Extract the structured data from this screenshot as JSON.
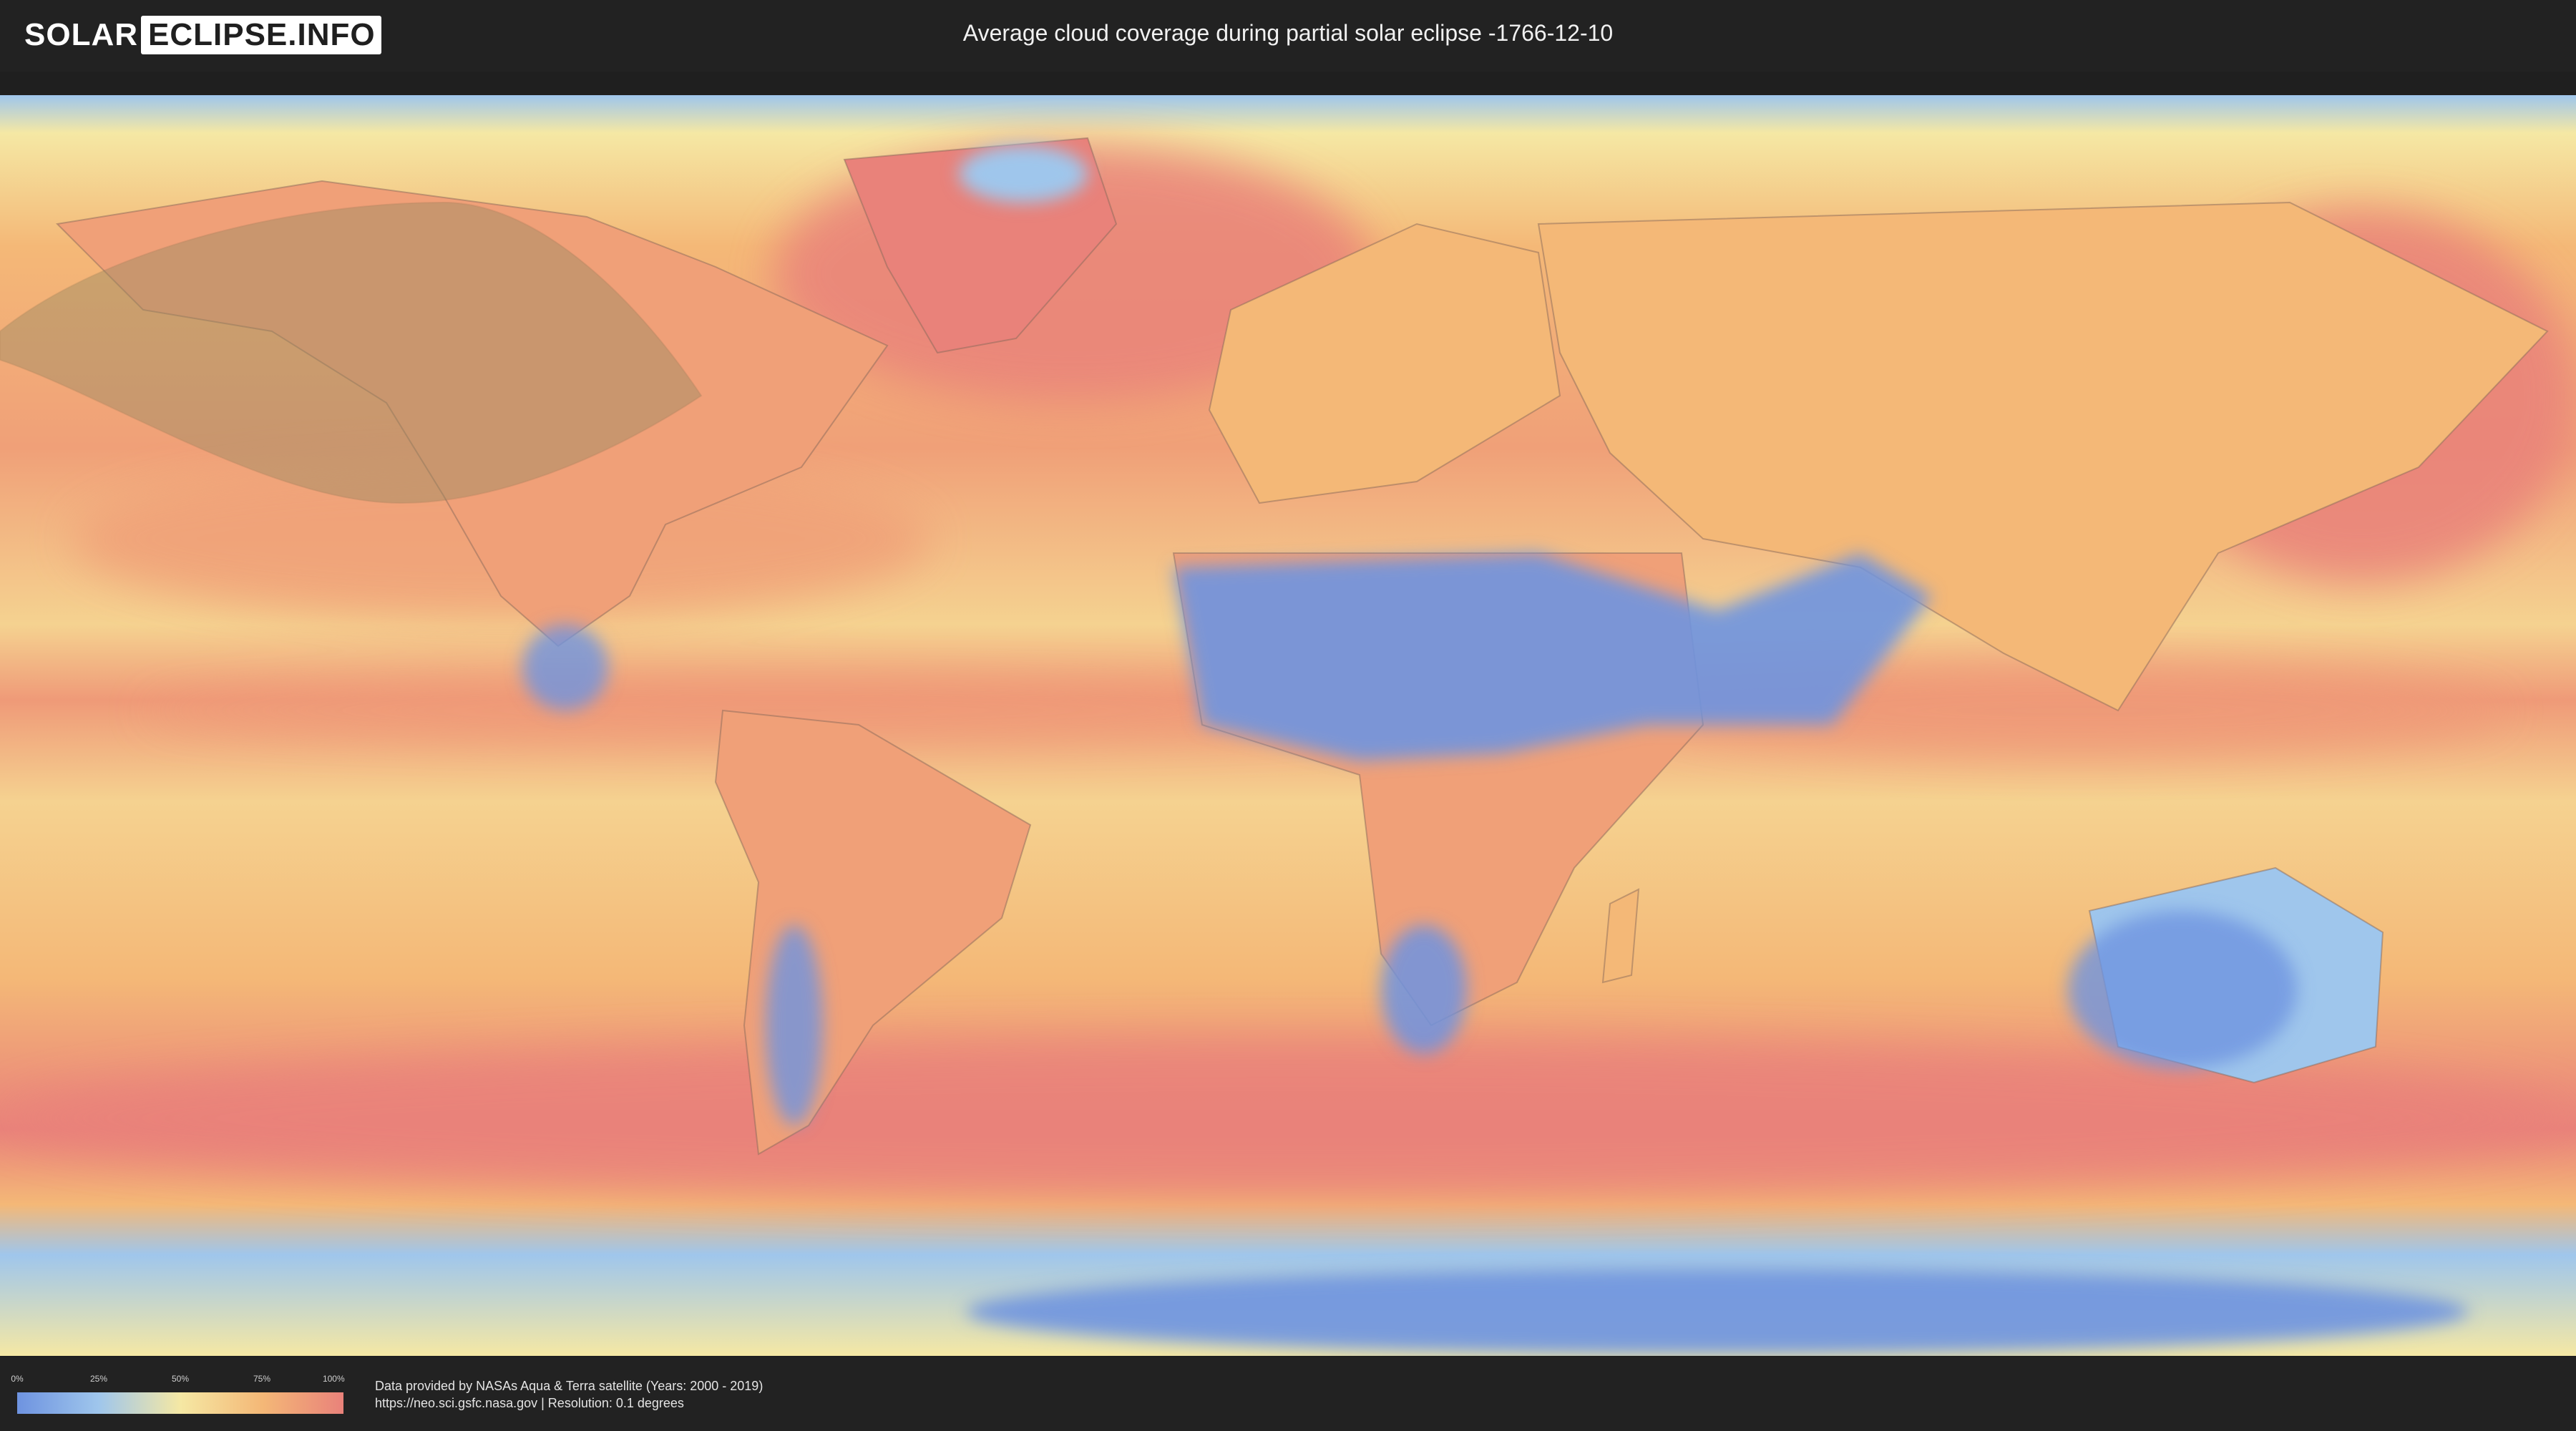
{
  "header": {
    "logo_solar": "SOLAR",
    "logo_eclipse": "ECLIPSE.INFO",
    "title": "Average cloud coverage during partial solar eclipse -1766-12-10"
  },
  "legend": {
    "ticks": [
      "0%",
      "25%",
      "50%",
      "75%",
      "100%"
    ],
    "colors": [
      "#6e93e0",
      "#9fc6ec",
      "#f5e8a4",
      "#f4b877",
      "#e9827a"
    ]
  },
  "credits": {
    "line1": "Data provided by NASAs Aqua & Terra satellite (Years: 2000 - 2019)",
    "line2": "https://neo.sci.gsfc.nasa.gov | Resolution: 0.1 degrees"
  },
  "map": {
    "eclipse_region_color": "#9a8a62",
    "ocean_high_cloud_color": "#e9827a",
    "clear_sky_color": "#6e93e0"
  }
}
